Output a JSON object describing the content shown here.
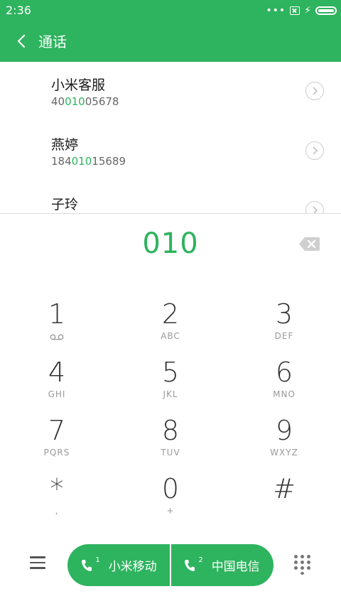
{
  "status_bar": {
    "time": "2:36",
    "dots": "•••"
  },
  "app_bar": {
    "title": "通话"
  },
  "contacts": [
    {
      "name": "小米客服",
      "number_pre": "40",
      "number_match": "010",
      "number_post": "05678"
    },
    {
      "name": "燕婷",
      "number_pre": "184",
      "number_match": "010",
      "number_post": "15689"
    },
    {
      "name": "子玲",
      "number_pre": "",
      "number_match": "",
      "number_post": ""
    }
  ],
  "dial_input": {
    "value": "010"
  },
  "keypad": [
    {
      "digit": "1",
      "letters": ""
    },
    {
      "digit": "2",
      "letters": "ABC"
    },
    {
      "digit": "3",
      "letters": "DEF"
    },
    {
      "digit": "4",
      "letters": "GHI"
    },
    {
      "digit": "5",
      "letters": "JKL"
    },
    {
      "digit": "6",
      "letters": "MNO"
    },
    {
      "digit": "7",
      "letters": "PQRS"
    },
    {
      "digit": "8",
      "letters": "TUV"
    },
    {
      "digit": "9",
      "letters": "WXYZ"
    },
    {
      "digit": "*",
      "letters": ","
    },
    {
      "digit": "0",
      "letters": "+"
    },
    {
      "digit": "#",
      "letters": ""
    }
  ],
  "call_buttons": {
    "sim1": {
      "label": "小米移动",
      "sim_number": "1"
    },
    "sim2": {
      "label": "中国电信",
      "sim_number": "2"
    }
  },
  "colors": {
    "accent": "#2eb35e"
  },
  "icons": {
    "back": "chevron-left-icon",
    "backspace": "backspace-icon",
    "menu": "menu-icon",
    "keypad_toggle": "dialpad-icon",
    "voicemail": "voicemail-icon",
    "call": "phone-icon"
  }
}
